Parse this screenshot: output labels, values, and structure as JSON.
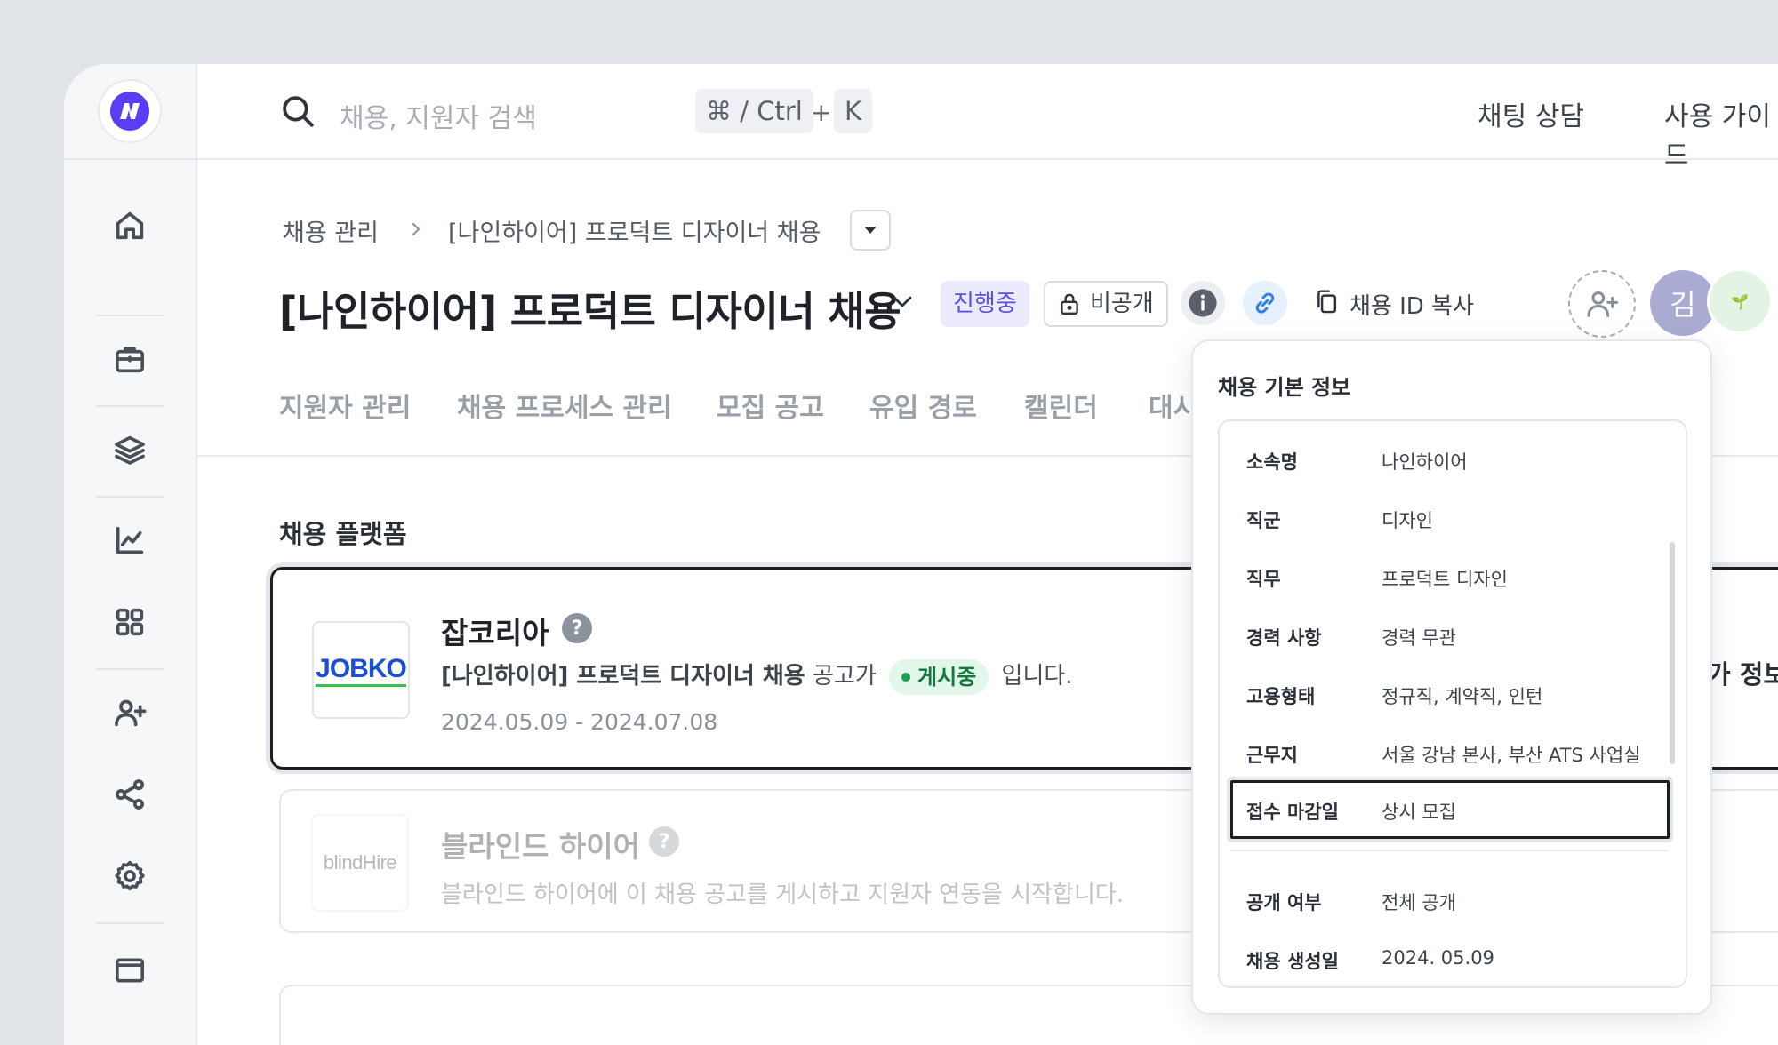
{
  "search": {
    "placeholder": "채용, 지원자 검색",
    "shortcut_mod": "⌘ / Ctrl",
    "shortcut_plus": "+",
    "shortcut_key": "K"
  },
  "topbar": {
    "chat_label": "채팅 상담",
    "guide_label": "사용 가이드"
  },
  "breadcrumb": {
    "root": "채용 관리",
    "current": "[나인하이어] 프로덕트 디자이너 채용"
  },
  "header": {
    "title": "[나인하이어] 프로덕트 디자이너 채용",
    "status": "진행중",
    "visibility": "비공개",
    "copy_id": "채용 ID 복사",
    "avatar_initial": "김",
    "avatar_emoji": "🌱"
  },
  "tabs": [
    "지원자 관리",
    "채용 프로세스 관리",
    "모집 공고",
    "유입 경로",
    "캘린더",
    "대시"
  ],
  "platforms": {
    "section_title": "채용 플랫폼",
    "items": [
      {
        "logo_text": "JOBKO",
        "name": "잡코리아",
        "job_title": "[나인하이어] 프로덕트 디자이너 채용",
        "text_mid": "공고가",
        "status": "게시중",
        "text_end": "입니다.",
        "dates": "2024.05.09 - 2024.07.08"
      },
      {
        "logo_text": "blindHire",
        "name": "블라인드 하이어",
        "description": "블라인드 하이어에 이 채용 공고를 게시하고 지원자 연동을 시작합니다."
      }
    ],
    "clipped_text": "가 정보"
  },
  "popover": {
    "title": "채용 기본 정보",
    "rows": [
      {
        "label": "소속명",
        "value": "나인하이어"
      },
      {
        "label": "직군",
        "value": "디자인"
      },
      {
        "label": "직무",
        "value": "프로덕트 디자인"
      },
      {
        "label": "경력 사항",
        "value": "경력 무관"
      },
      {
        "label": "고용형태",
        "value": "정규직, 계약직, 인턴"
      },
      {
        "label": "근무지",
        "value": "서울 강남 본사, 부산 ATS 사업실"
      },
      {
        "label": "접수 마감일",
        "value": "상시 모집"
      },
      {
        "label": "공개 여부",
        "value": "전체 공개"
      },
      {
        "label": "채용 생성일",
        "value": "2024. 05.09"
      }
    ]
  },
  "colors": {
    "accent": "#5a4fe0",
    "status_green": "#1e9e55",
    "avatar_bg": "#a9abd2"
  }
}
